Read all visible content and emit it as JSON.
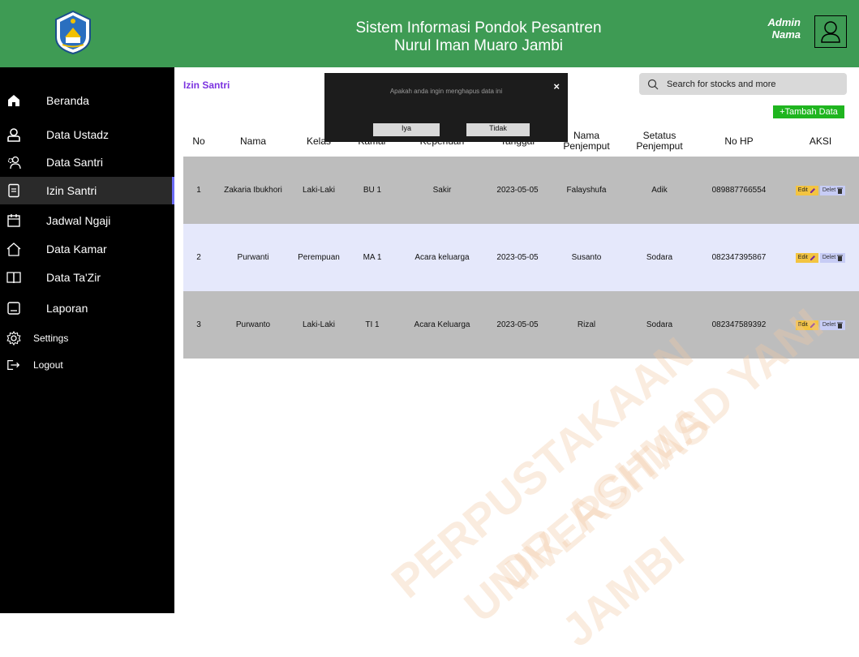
{
  "header": {
    "title_line1": "Sistem Informasi Pondok Pesantren",
    "title_line2": "Nurul Iman Muaro Jambi",
    "admin_label": "Admin",
    "name_label": "Nama",
    "logo_icon": "pesantren-emblem-logo",
    "avatar_icon": "user-avatar-icon",
    "color": "#3e9b54"
  },
  "sidebar": {
    "items": [
      {
        "label": "Beranda",
        "icon": "home-icon"
      },
      {
        "label": "Data Ustadz",
        "icon": "user-icon"
      },
      {
        "label": "Data Santri",
        "icon": "users-icon"
      },
      {
        "label": "Izin Santri",
        "icon": "document-icon"
      },
      {
        "label": "Jadwal Ngaji",
        "icon": "calendar-icon"
      },
      {
        "label": "Data Kamar",
        "icon": "house-outline-icon"
      },
      {
        "label": "Data Ta'Zir",
        "icon": "book-icon"
      },
      {
        "label": "Laporan",
        "icon": "report-icon"
      },
      {
        "label": "Settings",
        "icon": "gear-icon"
      },
      {
        "label": "Logout",
        "icon": "logout-icon"
      }
    ],
    "active_color": "#6b6cf6"
  },
  "main": {
    "section_title": "Izin Santri",
    "search_placeholder": "Search for stocks and more",
    "add_button": "+Tambah Data"
  },
  "table": {
    "headers": [
      "No",
      "Nama",
      "Kelas",
      "Kamar",
      "Keperluan",
      "Tanggal",
      "Nama Penjemput",
      "Setatus Penjemput",
      "No HP",
      "AKSI"
    ],
    "rows": [
      [
        "1",
        "Zakaria Ibukhori",
        "Laki-Laki",
        "BU 1",
        "Sakir",
        "2023-05-05",
        "Falayshufa",
        "Adik",
        "089887766554"
      ],
      [
        "2",
        "Purwanti",
        "Perempuan",
        "MA 1",
        "Acara keluarga",
        "2023-05-05",
        "Susanto",
        "Sodara",
        "082347395867"
      ],
      [
        "3",
        "Purwanto",
        "Laki-Laki",
        "TI 1",
        "Acara Keluarga",
        "2023-05-05",
        "Rizal",
        "Sodara",
        "082347589392"
      ]
    ],
    "edit_label": "Edit",
    "delete_label": "Delet"
  },
  "modal": {
    "message": "Apakah anda ingin menghapus data ini",
    "yes_label": "Iya",
    "no_label": "Tidak",
    "close_label": "×"
  },
  "watermark": {
    "lines": [
      "PERPUSTAKAAN",
      "UNIVERSITAS",
      "DR. ACHMAD YANI",
      "JAMBI"
    ]
  }
}
